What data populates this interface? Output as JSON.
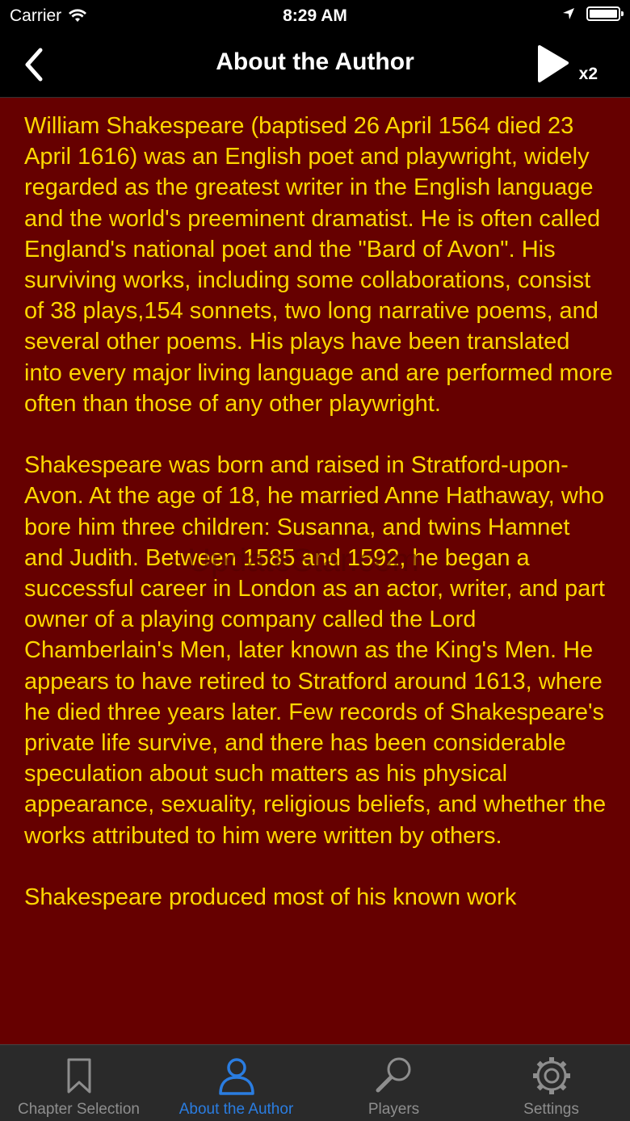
{
  "status_bar": {
    "carrier": "Carrier",
    "time": "8:29 AM"
  },
  "nav": {
    "title": "About the Author",
    "play_speed": "x2"
  },
  "content": {
    "paragraphs": [
      "William Shakespeare (baptised 26 April 1564 died 23 April 1616) was an English poet and playwright, widely regarded as the greatest writer in the English language and the world's preeminent dramatist. He is often called England's national poet and the \"Bard of Avon\". His surviving works, including some collaborations, consist of 38 plays,154 sonnets, two long narrative poems, and several other poems. His plays have been translated into every major living language and are performed more often than those of any other playwright.",
      "Shakespeare was born and raised in Stratford-upon-Avon. At the age of 18, he married Anne Hathaway, who bore him three children: Susanna, and twins Hamnet and Judith. Between 1585 and 1592, he began a successful career in London as an actor, writer, and part owner of a playing company called the Lord Chamberlain's Men, later known as the King's Men. He appears to have retired to Stratford around 1613, where he died three years later. Few records of Shakespeare's private life survive, and there has been considerable speculation about such matters as his physical appearance, sexuality, religious beliefs, and whether the works attributed to him were written by others.",
      "Shakespeare produced most of his known work"
    ],
    "watermark": "UpdateStar.com"
  },
  "tabs": [
    {
      "label": "Chapter Selection",
      "icon": "bookmark-icon",
      "active": false
    },
    {
      "label": "About the Author",
      "icon": "person-icon",
      "active": true
    },
    {
      "label": "Players",
      "icon": "magnifier-icon",
      "active": false
    },
    {
      "label": "Settings",
      "icon": "gear-icon",
      "active": false
    }
  ],
  "colors": {
    "content_background": "#660000",
    "content_text": "#ffd700",
    "tab_active": "#2a7de1",
    "tab_inactive": "#8e8e8e"
  }
}
